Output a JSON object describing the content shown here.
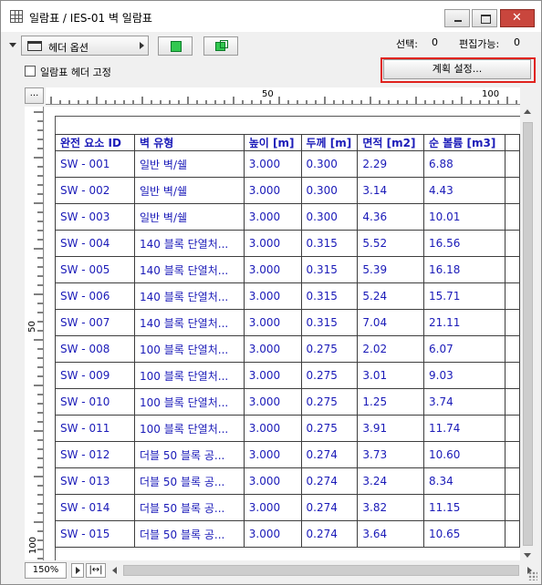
{
  "window": {
    "title": "일람표 / IES-01 벽 일람표"
  },
  "toolbar": {
    "header_options_label": "헤더 옵션",
    "selection_label": "선택:",
    "selection_count": "0",
    "editable_label": "편집가능:",
    "editable_count": "0",
    "freeze_header_label": "일람표 헤더 고정",
    "plan_setup_label": "계획 설정..."
  },
  "ruler": {
    "corner": "...",
    "h_labels": [
      "50",
      "100"
    ],
    "v_labels": [
      "50",
      "100"
    ]
  },
  "schedule": {
    "columns": [
      "완전 요소 ID",
      "벽 유형",
      "높이 [m]",
      "두께 [m]",
      "면적 [m2]",
      "순 볼륨 [m3]"
    ],
    "rows": [
      [
        "SW - 001",
        "일반 벽/쉘",
        "3.000",
        "0.300",
        "2.29",
        "6.88"
      ],
      [
        "SW - 002",
        "일반 벽/쉘",
        "3.000",
        "0.300",
        "3.14",
        "4.43"
      ],
      [
        "SW - 003",
        "일반 벽/쉘",
        "3.000",
        "0.300",
        "4.36",
        "10.01"
      ],
      [
        "SW - 004",
        "140 블록 단열처...",
        "3.000",
        "0.315",
        "5.52",
        "16.56"
      ],
      [
        "SW - 005",
        "140 블록 단열처...",
        "3.000",
        "0.315",
        "5.39",
        "16.18"
      ],
      [
        "SW - 006",
        "140 블록 단열처...",
        "3.000",
        "0.315",
        "5.24",
        "15.71"
      ],
      [
        "SW - 007",
        "140 블록 단열처...",
        "3.000",
        "0.315",
        "7.04",
        "21.11"
      ],
      [
        "SW - 008",
        "100 블록 단열처...",
        "3.000",
        "0.275",
        "2.02",
        "6.07"
      ],
      [
        "SW - 009",
        "100 블록 단열처...",
        "3.000",
        "0.275",
        "3.01",
        "9.03"
      ],
      [
        "SW - 010",
        "100 블록 단열처...",
        "3.000",
        "0.275",
        "1.25",
        "3.74"
      ],
      [
        "SW - 011",
        "100 블록 단열처...",
        "3.000",
        "0.275",
        "3.91",
        "11.74"
      ],
      [
        "SW - 012",
        "더블 50 블록 공...",
        "3.000",
        "0.274",
        "3.73",
        "10.60"
      ],
      [
        "SW - 013",
        "더블 50 블록 공...",
        "3.000",
        "0.274",
        "3.24",
        "8.34"
      ],
      [
        "SW - 014",
        "더블 50 블록 공...",
        "3.000",
        "0.274",
        "3.82",
        "11.15"
      ],
      [
        "SW - 015",
        "더블 50 블록 공...",
        "3.000",
        "0.274",
        "3.64",
        "10.65"
      ]
    ]
  },
  "statusbar": {
    "zoom": "150%",
    "fit_glyph": "|↔|"
  },
  "colors": {
    "cell_text": "#1a1ab8",
    "highlight_frame": "#e0231d",
    "close_button": "#c9463d"
  }
}
